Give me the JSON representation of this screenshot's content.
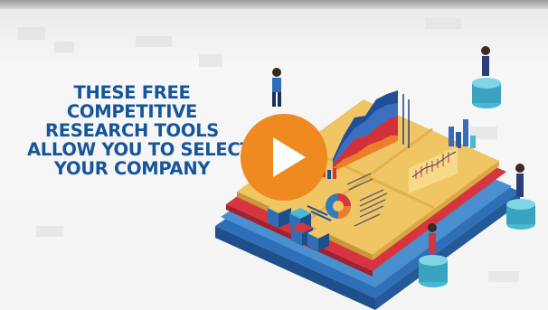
{
  "video": {
    "headline_lines": [
      "THESE FREE",
      "COMPETITIVE",
      "RESEARCH TOOLS",
      "ALLOW YOU TO SELECT",
      "YOUR COMPANY"
    ],
    "play_icon": "play-icon",
    "colors": {
      "headline": "#16559a",
      "play_button": "#ef8a21",
      "board_yellow": "#efc260",
      "board_red": "#d9363e",
      "board_blue": "#2f7dc0",
      "pedestal_cyan": "#49b8d2"
    }
  }
}
